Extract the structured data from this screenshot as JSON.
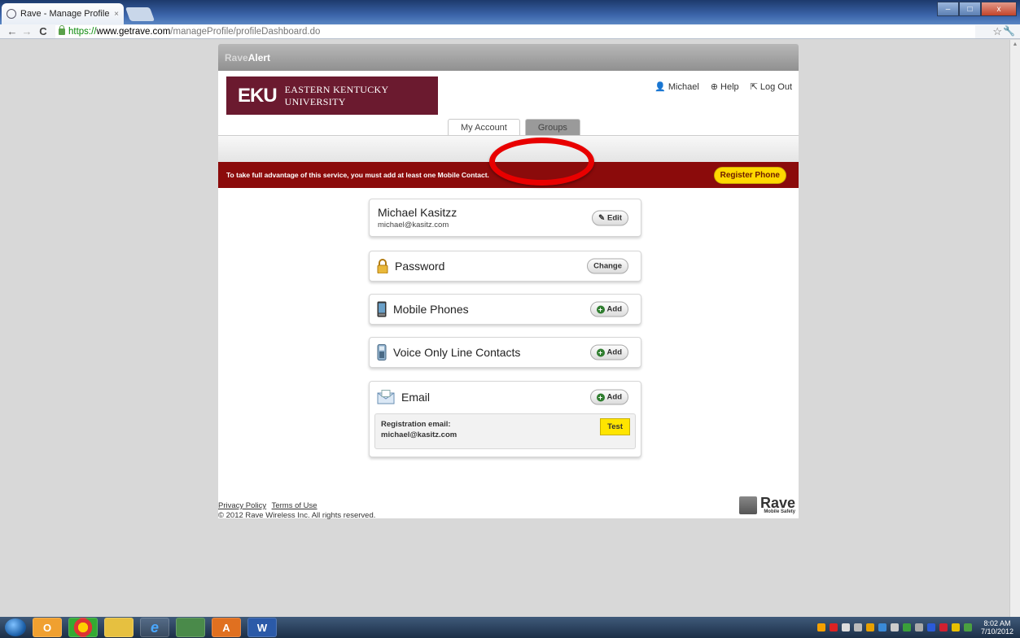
{
  "browser": {
    "tab_title": "Rave - Manage Profile Dasl",
    "tab_close": "×",
    "url_scheme": "https://",
    "url_host": "www.getrave.com",
    "url_path": "/manageProfile/profileDashboard.do",
    "minimize": "–",
    "maximize": "□",
    "close": "x"
  },
  "app": {
    "brand_rave": "Rave",
    "brand_alert": "Alert",
    "logo_mark": "EKU",
    "logo_text": "EASTERN KENTUCKY UNIVERSITY",
    "topnav": {
      "user": "Michael",
      "help": "Help",
      "logout": "Log Out"
    },
    "tabs": [
      {
        "label": "My Account",
        "active": true
      },
      {
        "label": "Groups",
        "active": false
      }
    ],
    "banner": {
      "message": "To take full advantage of this service, you must add at least one Mobile Contact.",
      "button": "Register Phone"
    },
    "profile": {
      "name": "Michael Kasitzz",
      "email": "michael@kasitz.com",
      "edit_label": "Edit"
    },
    "password": {
      "label": "Password",
      "button": "Change"
    },
    "mobile": {
      "label": "Mobile Phones",
      "button": "Add"
    },
    "voice": {
      "label": "Voice Only Line Contacts",
      "button": "Add"
    },
    "email": {
      "label": "Email",
      "button": "Add",
      "reg_label": "Registration email:",
      "reg_value": "michael@kasitz.com",
      "test_button": "Test"
    },
    "footer": {
      "privacy": "Privacy Policy",
      "terms": "Terms of Use",
      "copyright": "© 2012 Rave Wireless Inc. All rights reserved.",
      "rave_word": "Rave",
      "rave_sub": "Mobile Safety"
    }
  },
  "taskbar": {
    "apps": [
      "O",
      "G",
      "",
      "e",
      "",
      "A",
      "W"
    ],
    "time": "8:02 AM",
    "date": "7/10/2012"
  },
  "colors": {
    "banner": "#8b0b0b",
    "logo": "#6b1a2f",
    "annotation_ring": "#e80000",
    "highlight": "#ffd800"
  }
}
